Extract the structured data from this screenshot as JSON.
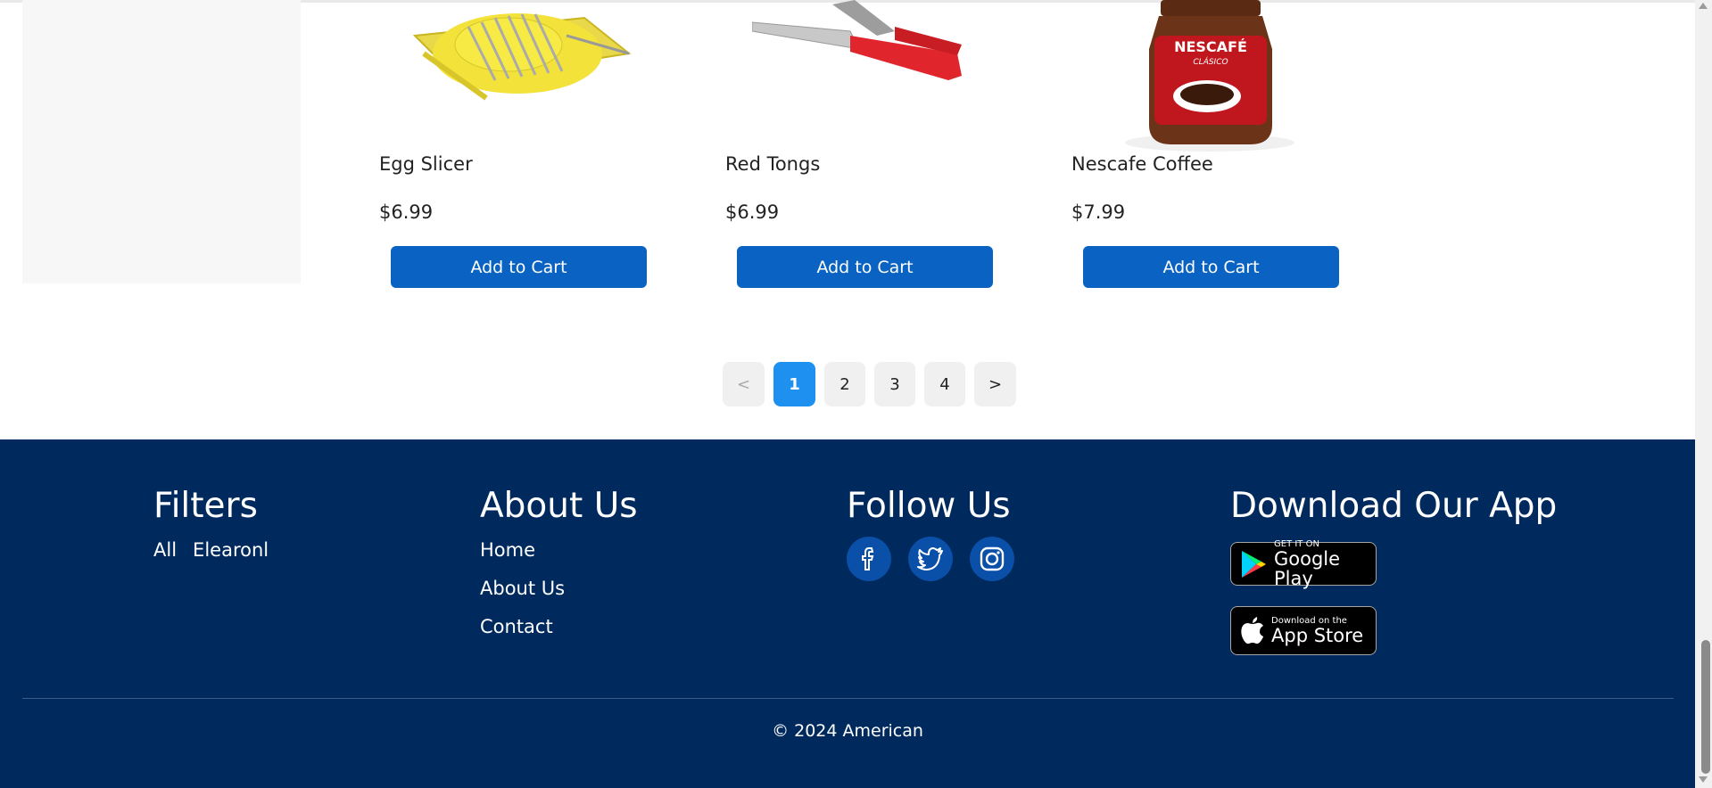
{
  "products": [
    {
      "name": "Egg Slicer",
      "price": "$6.99",
      "cta": "Add to Cart",
      "image_icon": "egg-slicer-image"
    },
    {
      "name": "Red Tongs",
      "price": "$6.99",
      "cta": "Add to Cart",
      "image_icon": "tongs-image"
    },
    {
      "name": "Nescafe Coffee",
      "price": "$7.99",
      "cta": "Add to Cart",
      "image_icon": "coffee-jar-image",
      "label_brand": "NESCAFÉ",
      "label_sub": "CLÁSICO"
    }
  ],
  "pagination": {
    "prev": "<",
    "pages": [
      "1",
      "2",
      "3",
      "4"
    ],
    "active": "1",
    "next": ">"
  },
  "footer": {
    "filters": {
      "title": "Filters",
      "links": [
        "All",
        "Elearonl"
      ]
    },
    "about": {
      "title": "About Us",
      "links": [
        "Home",
        "About Us",
        "Contact"
      ]
    },
    "follow": {
      "title": "Follow Us",
      "icons": [
        "facebook-icon",
        "twitter-icon",
        "instagram-icon"
      ]
    },
    "app": {
      "title": "Download Our App",
      "google_small": "GET IT ON",
      "google_big": "Google Play",
      "apple_small": "Download on the",
      "apple_big": "App Store"
    },
    "copyright": "© 2024 American"
  },
  "colors": {
    "primary_button": "#0a63c2",
    "active_page": "#1e90f0",
    "footer_bg": "#002a5e",
    "social_circle": "#0a4fa8"
  }
}
